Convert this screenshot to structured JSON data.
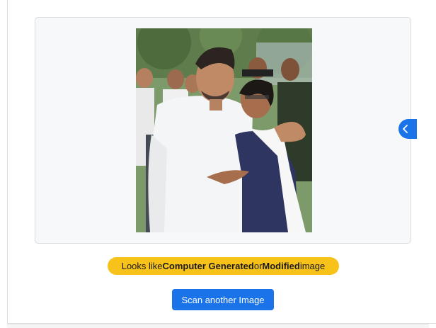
{
  "result": {
    "prefix": "Looks like ",
    "term1": "Computer Generated",
    "joiner": " or ",
    "term2": "Modified",
    "suffix": " image",
    "badge_color": "#f7c21a"
  },
  "actions": {
    "scan_label": "Scan another Image",
    "next_icon": "chevron-left-icon"
  },
  "colors": {
    "accent": "#1a73e8",
    "viewer_bg": "#f7f8fa"
  }
}
